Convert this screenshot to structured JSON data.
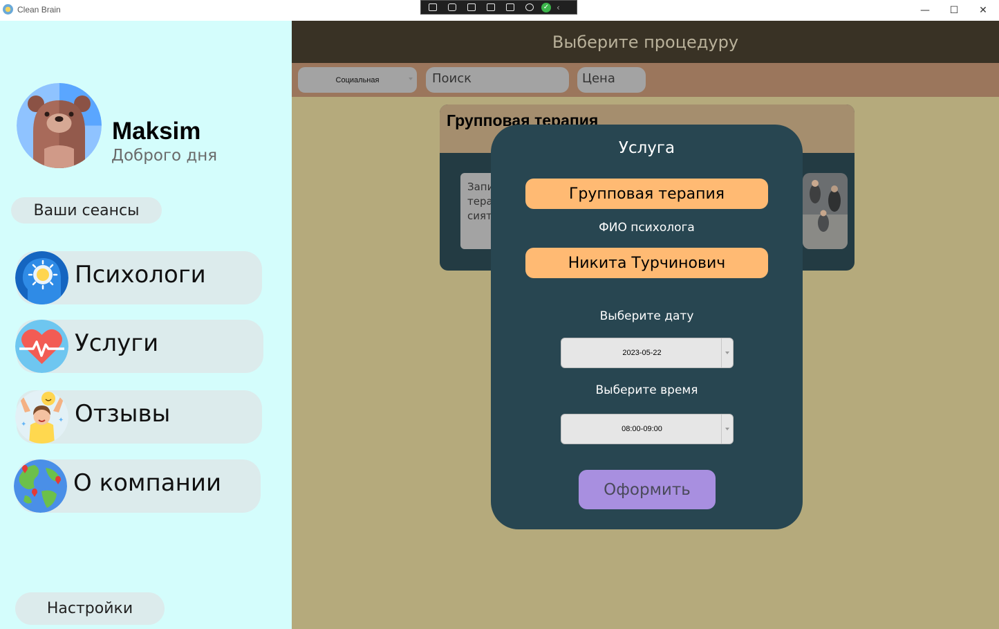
{
  "window": {
    "title": "Clean Brain",
    "controls": {
      "minimize": "—",
      "maximize": "☐",
      "close": "✕"
    }
  },
  "debug_toolbar": {
    "icons": [
      "select-element-icon",
      "record-icon",
      "pointer-icon",
      "frame-icon",
      "layout-icon",
      "hot-reload-icon",
      "check-icon",
      "collapse-icon"
    ]
  },
  "sidebar": {
    "user": {
      "name": "Maksim",
      "greeting": "Доброго дня",
      "avatar_icon": "bear-avatar-icon"
    },
    "sessions_label": "Ваши сеансы",
    "nav": [
      {
        "label": "Психологи",
        "icon": "mind-icon"
      },
      {
        "label": "Услуги",
        "icon": "heart-pulse-icon"
      },
      {
        "label": "Отзывы",
        "icon": "happy-person-icon"
      },
      {
        "label": "О компании",
        "icon": "globe-icon"
      }
    ],
    "settings_label": "Настройки",
    "background": "#d4fdfc"
  },
  "main": {
    "header_title": "Выберите процедуру",
    "filters": {
      "category": "Социальная",
      "search_placeholder": "Поиск",
      "price_placeholder": "Цена"
    },
    "card": {
      "title": "Групповая терапия",
      "description": "Запи\nтера\nсият"
    },
    "background": "#b5aa7c"
  },
  "modal": {
    "title": "Услуга",
    "service": "Групповая терапия",
    "psychologist_label": "ФИО психолога",
    "psychologist": "Никита Турчинович",
    "date_label": "Выберите дату",
    "date_value": "2023-05-22",
    "time_label": "Выберите время",
    "time_value": "08:00-09:00",
    "submit_label": "Оформить",
    "accent": "#ffba73",
    "button_color": "#a88fe0"
  }
}
